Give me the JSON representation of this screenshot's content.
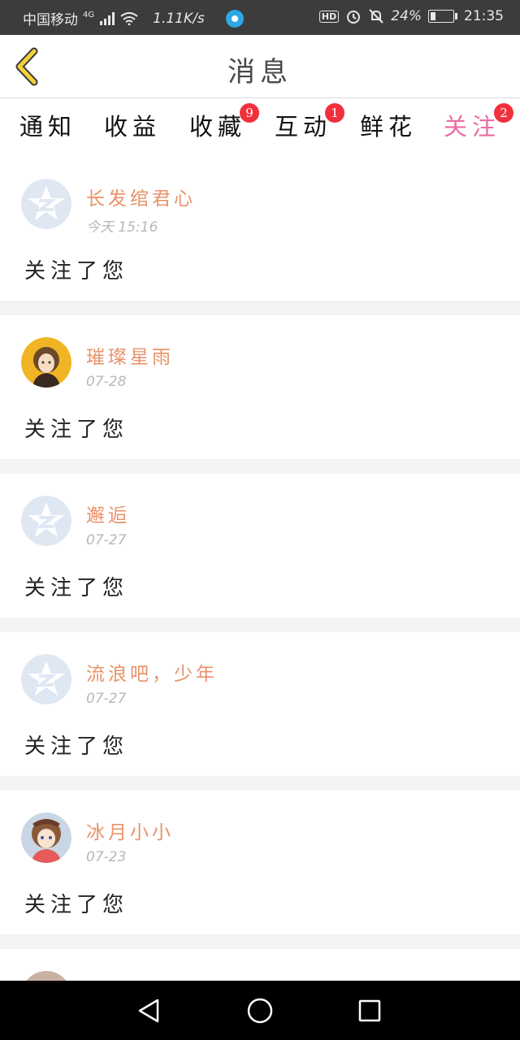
{
  "status_bar": {
    "carrier": "中国移动",
    "network_type": "4G",
    "net_speed": "1.11K/s",
    "hd_label": "HD",
    "battery_percent": "24%",
    "battery_level": 0.24,
    "time": "21:35"
  },
  "header": {
    "title": "消息"
  },
  "tabs": [
    {
      "label": "通知",
      "badge": ""
    },
    {
      "label": "收益",
      "badge": ""
    },
    {
      "label": "收藏",
      "badge": "9"
    },
    {
      "label": "互动",
      "badge": "1"
    },
    {
      "label": "鲜花",
      "badge": ""
    },
    {
      "label": "关注",
      "badge": "2",
      "active": true
    }
  ],
  "messages": [
    {
      "name": "长发绾君心",
      "time": "今天 15:16",
      "text": "关注了您",
      "avatar": "default-avatar"
    },
    {
      "name": "璀璨星雨",
      "time": "07-28",
      "text": "关注了您",
      "avatar": "anime-girl-avatar"
    },
    {
      "name": "邂逅",
      "time": "07-27",
      "text": "关注了您",
      "avatar": "default-avatar"
    },
    {
      "name": "流浪吧，少年",
      "time": "07-27",
      "text": "关注了您",
      "avatar": "default-avatar"
    },
    {
      "name": "冰月小小",
      "time": "07-23",
      "text": "关注了您",
      "avatar": "anime-girl-avatar"
    }
  ],
  "colors": {
    "accent": "#e96ca3",
    "username": "#e8926a",
    "badge": "#f0303d",
    "back_icon": "#f2d23a"
  }
}
